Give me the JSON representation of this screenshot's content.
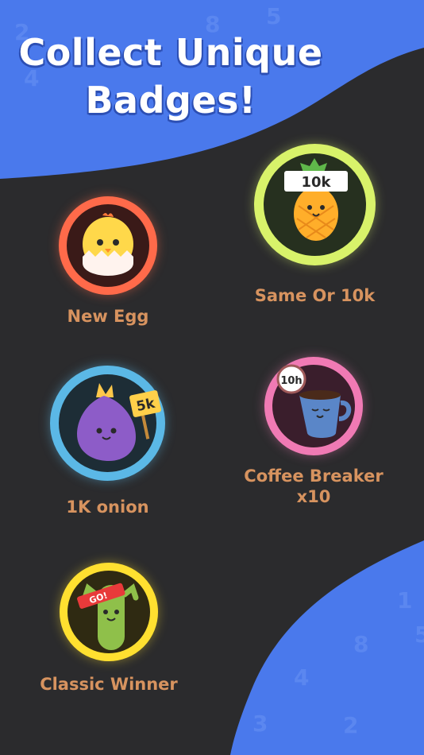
{
  "header": {
    "title_line1": "Collect Unique",
    "title_line2": "Badges!"
  },
  "badges": [
    {
      "label": "New Egg",
      "ring_color": "#ff6a4a",
      "icon": "chick-in-egg-icon"
    },
    {
      "label": "Same Or 10k",
      "ring_color": "#d8f26a",
      "icon": "pineapple-icon",
      "sign": "10k"
    },
    {
      "label": "1K onion",
      "ring_color": "#5bb8e6",
      "icon": "onion-icon",
      "sign": "5k"
    },
    {
      "label": "Coffee Breaker",
      "label_line2": "x10",
      "ring_color": "#f07ab4",
      "icon": "coffee-cup-icon",
      "sign": "10h"
    },
    {
      "label": "Classic Winner",
      "ring_color": "#ffe030",
      "icon": "cucumber-icon",
      "sign": "GO!"
    }
  ],
  "colors": {
    "blue": "#4a79ec",
    "dark": "#2b2b2d",
    "label": "#d7935f"
  }
}
